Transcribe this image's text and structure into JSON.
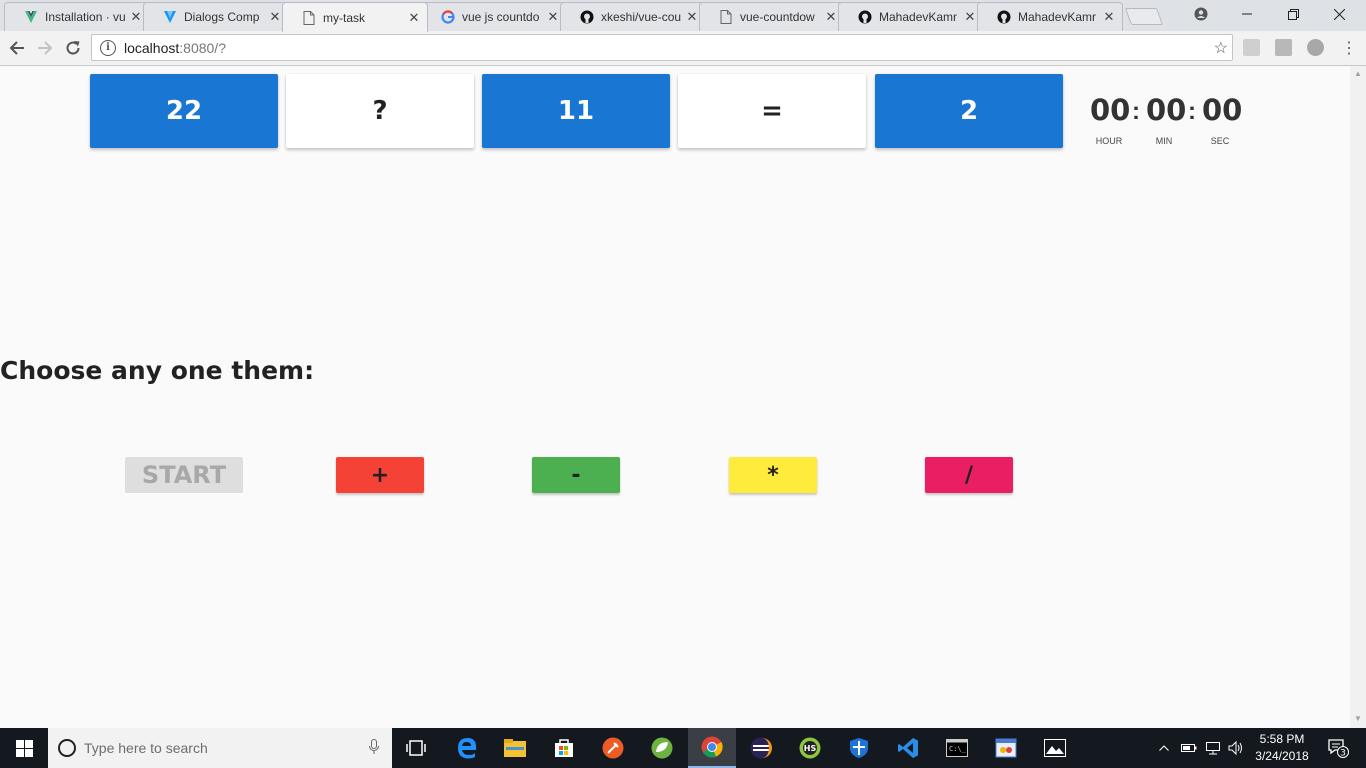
{
  "browser": {
    "tabs": [
      {
        "title": "Installation · vu",
        "icon": "vuetify-icon"
      },
      {
        "title": "Dialogs Comp",
        "icon": "vuetify-icon"
      },
      {
        "title": "my-task",
        "icon": "page-icon",
        "active": true
      },
      {
        "title": "vue js countdo",
        "icon": "google-icon"
      },
      {
        "title": "xkeshi/vue-cou",
        "icon": "github-icon"
      },
      {
        "title": "vue-countdow",
        "icon": "page-icon"
      },
      {
        "title": "MahadevKamr",
        "icon": "github-icon"
      },
      {
        "title": "MahadevKamr",
        "icon": "github-icon"
      }
    ],
    "tab_close": "✕",
    "url_host": "localhost",
    "url_rest": ":8080/?"
  },
  "equation": {
    "operand1": "22",
    "operator": "?",
    "operand2": "11",
    "equals": "=",
    "result": "2"
  },
  "timer": {
    "hours": "00",
    "minutes": "00",
    "seconds": "00",
    "separator": ":",
    "hour_label": "HOUR",
    "min_label": "MIN",
    "sec_label": "SEC"
  },
  "prompt": "Choose any one them:",
  "buttons": {
    "start": "START",
    "plus": "+",
    "minus": "-",
    "multiply": "*",
    "divide": "/"
  },
  "colors": {
    "card_blue": "#1976d2",
    "plus": "#f44336",
    "minus": "#4caf50",
    "multiply": "#ffeb3b",
    "divide": "#e91e63"
  },
  "taskbar": {
    "search_placeholder": "Type here to search",
    "time": "5:58 PM",
    "date": "3/24/2018",
    "notification_count": "3"
  }
}
